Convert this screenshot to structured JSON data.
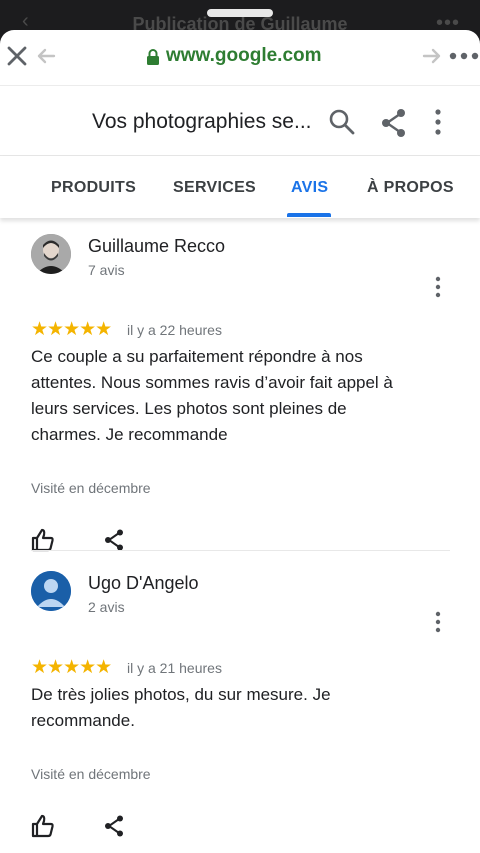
{
  "background_app": {
    "title": "Publication de Guillaume"
  },
  "browser": {
    "url": "www.google.com",
    "url_color": "#2e7d32",
    "icons": [
      "close-icon",
      "back-arrow-icon",
      "lock-icon",
      "forward-arrow-icon",
      "more-horizontal-icon"
    ]
  },
  "header": {
    "title": "Vos photographies se...",
    "icons": [
      "search-icon",
      "share-icon",
      "more-vertical-icon"
    ]
  },
  "tabs": [
    {
      "label": "PRODUITS",
      "active": false
    },
    {
      "label": "SERVICES",
      "active": false
    },
    {
      "label": "AVIS",
      "active": true
    },
    {
      "label": "À PROPOS",
      "active": false
    }
  ],
  "accent_color": "#1a73e8",
  "star_color": "#f4b400",
  "reviews": [
    {
      "name": "Guillaume Recco",
      "count": "7 avis",
      "stars": "★★★★★",
      "rating": 5,
      "time": "il y a 22 heures",
      "text": "Ce couple a su parfaitement répondre à nos attentes. Nous sommes ravis d’avoir fait appel à leurs services. Les photos sont pleines de charmes. Je recommande",
      "visited": "Visité en décembre"
    },
    {
      "name": "Ugo D'Angelo",
      "count": "2 avis",
      "stars": "★★★★★",
      "rating": 5,
      "time": "il y a 21 heures",
      "text": "De très jolies photos, du sur mesure. Je recommande.",
      "visited": "Visité en décembre"
    }
  ]
}
